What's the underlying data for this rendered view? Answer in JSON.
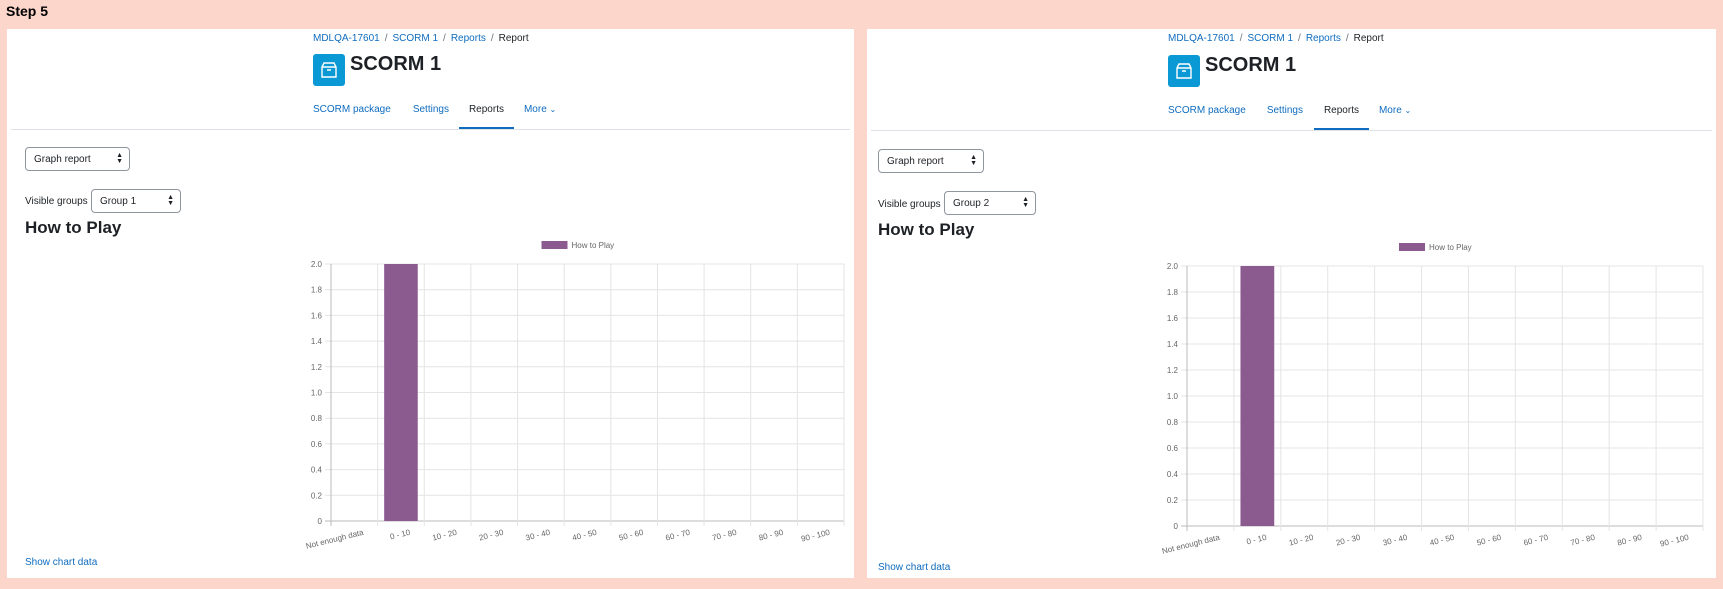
{
  "step_title": "Step 5",
  "panels": [
    {
      "breadcrumb": [
        "MDLQA-17601",
        "SCORM 1",
        "Reports",
        "Report"
      ],
      "icon": "package-icon",
      "title": "SCORM 1",
      "tabs": [
        "SCORM package",
        "Settings",
        "Reports",
        "More"
      ],
      "active_tab": "Reports",
      "report_select": "Graph report",
      "visible_groups_label": "Visible groups",
      "group_select": "Group 1",
      "section_title": "How to Play",
      "show_chart_data": "Show chart data"
    },
    {
      "breadcrumb": [
        "MDLQA-17601",
        "SCORM 1",
        "Reports",
        "Report"
      ],
      "icon": "package-icon",
      "title": "SCORM 1",
      "tabs": [
        "SCORM package",
        "Settings",
        "Reports",
        "More"
      ],
      "active_tab": "Reports",
      "report_select": "Graph report",
      "visible_groups_label": "Visible groups",
      "group_select": "Group 2",
      "section_title": "How to Play",
      "show_chart_data": "Show chart data"
    }
  ],
  "colors": {
    "bar": "#8b5a8f",
    "link": "#0f6cbf",
    "icon_bg": "#0b99d6"
  },
  "chart_data": [
    {
      "type": "bar",
      "categories": [
        "Not enough data",
        "0 - 10",
        "10 - 20",
        "20 - 30",
        "30 - 40",
        "40 - 50",
        "50 - 60",
        "60 - 70",
        "70 - 80",
        "80 - 90",
        "90 - 100"
      ],
      "series": [
        {
          "name": "How to Play",
          "values": [
            0,
            2,
            0,
            0,
            0,
            0,
            0,
            0,
            0,
            0,
            0
          ]
        }
      ],
      "yticks": [
        "0",
        "0.2",
        "0.4",
        "0.6",
        "0.8",
        "1.0",
        "1.2",
        "1.4",
        "1.6",
        "1.8",
        "2.0"
      ],
      "ylim": [
        0,
        2
      ],
      "legend": "top",
      "grid": true
    },
    {
      "type": "bar",
      "categories": [
        "Not enough data",
        "0 - 10",
        "10 - 20",
        "20 - 30",
        "30 - 40",
        "40 - 50",
        "50 - 60",
        "60 - 70",
        "70 - 80",
        "80 - 90",
        "90 - 100"
      ],
      "series": [
        {
          "name": "How to Play",
          "values": [
            0,
            2,
            0,
            0,
            0,
            0,
            0,
            0,
            0,
            0,
            0
          ]
        }
      ],
      "yticks": [
        "0",
        "0.2",
        "0.4",
        "0.6",
        "0.8",
        "1.0",
        "1.2",
        "1.4",
        "1.6",
        "1.8",
        "2.0"
      ],
      "ylim": [
        0,
        2
      ],
      "legend": "top",
      "grid": true
    }
  ]
}
